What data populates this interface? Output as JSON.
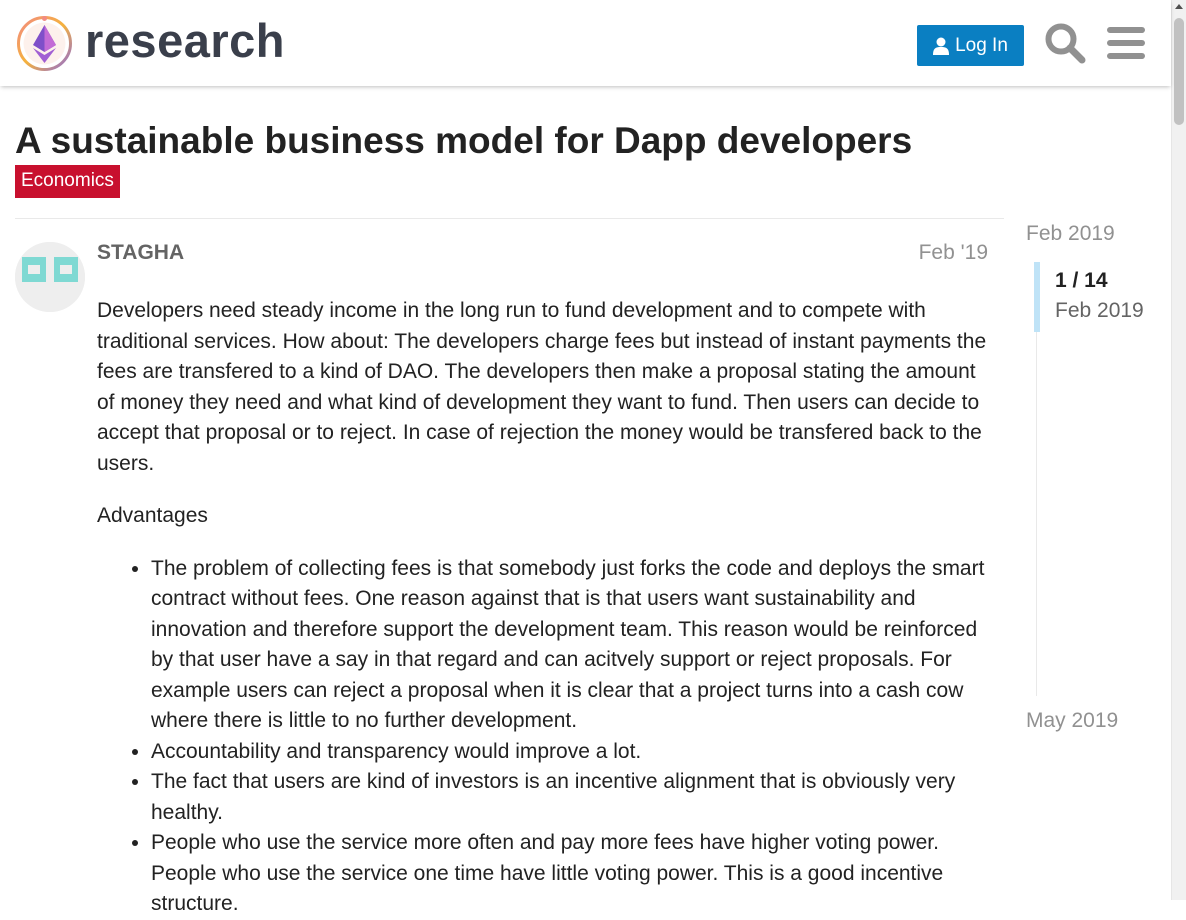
{
  "header": {
    "logo_text": "research",
    "login_label": "Log In",
    "search_icon": "search-icon",
    "menu_icon": "hamburger-menu-icon"
  },
  "topic": {
    "title": "A sustainable business model for Dapp developers",
    "category": "Economics",
    "category_color": "#c8102e"
  },
  "post": {
    "username": "STAGHA",
    "date": "Feb '19",
    "paragraphs": [
      "Developers need steady income in the long run to fund development and to compete with traditional services. How about: The developers charge fees but instead of instant payments the fees are transfered to a kind of DAO. The developers then make a proposal stating the amount of money they need and what kind of development they want to fund. Then users can decide to accept that proposal or to reject. In case of rejection the money would be transfered back to the users.",
      "Advantages"
    ],
    "bullets": [
      "The problem of collecting fees is that somebody just forks the code and deploys the smart contract without fees. One reason against that is that users want sustainability and innovation and therefore support the development team. This reason would be reinforced by that user have a say in that regard and can acitvely support or reject proposals. For example users can reject a proposal when it is clear that a project turns into a cash cow where there is little to no further development.",
      "Accountability and transparency would improve a lot.",
      "The fact that users are kind of investors is an incentive alignment that is obviously very healthy.",
      "People who use the service more often and pay more fees have higher voting power. People who use the service one time have little voting power. This is a good incentive structure."
    ]
  },
  "timeline": {
    "start_label": "Feb 2019",
    "position": "1 / 14",
    "current_date": "Feb 2019",
    "end_label": "May 2019"
  },
  "colors": {
    "accent": "#0a7fc2",
    "timeline_handle": "#bfe3f7",
    "avatar_glyph": "#7fd9d3"
  }
}
